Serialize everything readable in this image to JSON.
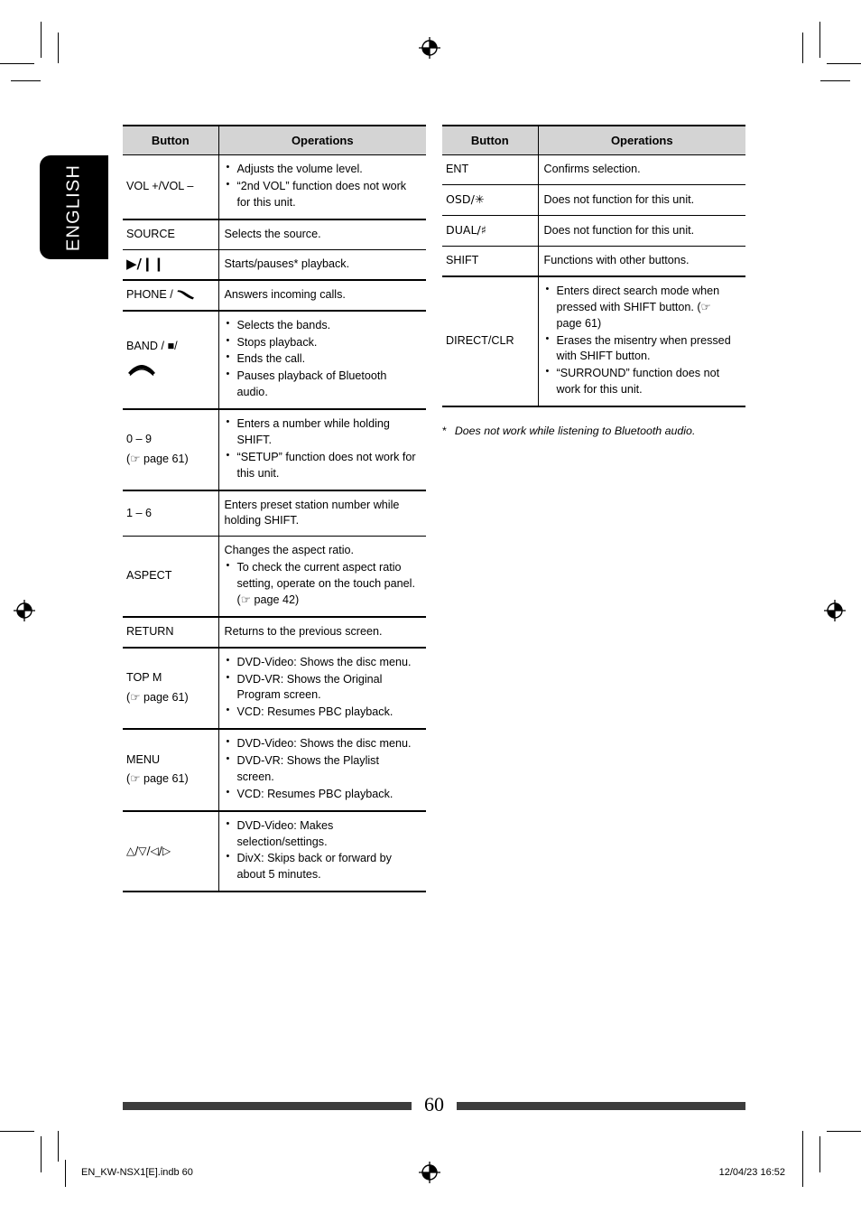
{
  "language_tab": {
    "label": "ENGLISH"
  },
  "left_table": {
    "headers": {
      "button": "Button",
      "operations": "Operations"
    },
    "rows": [
      {
        "button": "VOL +/VOL –",
        "ops": [
          "Adjusts the volume level.",
          "“2nd VOL” function does not work for this unit."
        ],
        "thick": true
      },
      {
        "button": "SOURCE",
        "ops_plain": "Selects the source."
      },
      {
        "button": "▶/❙❙",
        "ops_plain": "Starts/pauses* playback.",
        "thick": true
      },
      {
        "button": "PHONE / ",
        "button_icon": "phone-handset-up-icon",
        "ops_plain": "Answers incoming calls.",
        "thick": true
      },
      {
        "button": "BAND / ■/",
        "button_icon2": "phone-handset-down-icon",
        "ops": [
          "Selects the bands.",
          "Stops playback.",
          "Ends the call.",
          "Pauses playback of Bluetooth audio."
        ],
        "thick": true
      },
      {
        "button": "0 – 9",
        "button_sub": "page 61",
        "ops": [
          "Enters a number while holding SHIFT.",
          "“SETUP” function does not work for this unit."
        ],
        "thick": true
      },
      {
        "button": "1 – 6",
        "ops_plain": "Enters preset station number while holding SHIFT."
      },
      {
        "button": "ASPECT",
        "ops_lead": "Changes the aspect ratio.",
        "ops": [
          "To check the current aspect ratio setting, operate on the touch panel. (☞ page 42)"
        ],
        "thick": true
      },
      {
        "button": "RETURN",
        "ops_plain": "Returns to the previous screen.",
        "thick": true
      },
      {
        "button": "TOP M",
        "button_sub": "page 61",
        "ops": [
          "DVD-Video: Shows the disc menu.",
          "DVD-VR: Shows the Original Program screen.",
          "VCD: Resumes PBC playback."
        ],
        "thick": true
      },
      {
        "button": "MENU",
        "button_sub": "page 61",
        "ops": [
          "DVD-Video: Shows the disc menu.",
          "DVD-VR: Shows the Playlist screen.",
          "VCD: Resumes PBC playback."
        ],
        "thick": true
      },
      {
        "button": "△/▽/◁/▷",
        "ops": [
          "DVD-Video: Makes selection/settings.",
          "DivX: Skips back or forward by about 5 minutes."
        ],
        "last": true
      }
    ]
  },
  "right_table": {
    "headers": {
      "button": "Button",
      "operations": "Operations"
    },
    "rows": [
      {
        "button": "ENT",
        "ops_plain": "Confirms selection."
      },
      {
        "button": "OSD/✳",
        "ops_plain": "Does not function for this unit."
      },
      {
        "button": "DUAL/♯",
        "ops_plain": "Does not function for this unit."
      },
      {
        "button": "SHIFT",
        "ops_plain": "Functions with other buttons.",
        "thick": true
      },
      {
        "button": "DIRECT/CLR",
        "ops": [
          "Enters direct search mode when pressed with SHIFT button. (☞ page 61)",
          "Erases the misentry when pressed with SHIFT button.",
          "“SURROUND” function does not work for this unit."
        ],
        "last": true
      }
    ],
    "footnote": {
      "marker": "*",
      "text": "Does not work while listening to Bluetooth audio."
    }
  },
  "page_footer": {
    "page_number": "60"
  },
  "imprint": {
    "file": "EN_KW-NSX1[E].indb   60",
    "datetime": "12/04/23   16:52"
  },
  "page_ref_prefix": "(☞ ",
  "page_ref_suffix": ")"
}
